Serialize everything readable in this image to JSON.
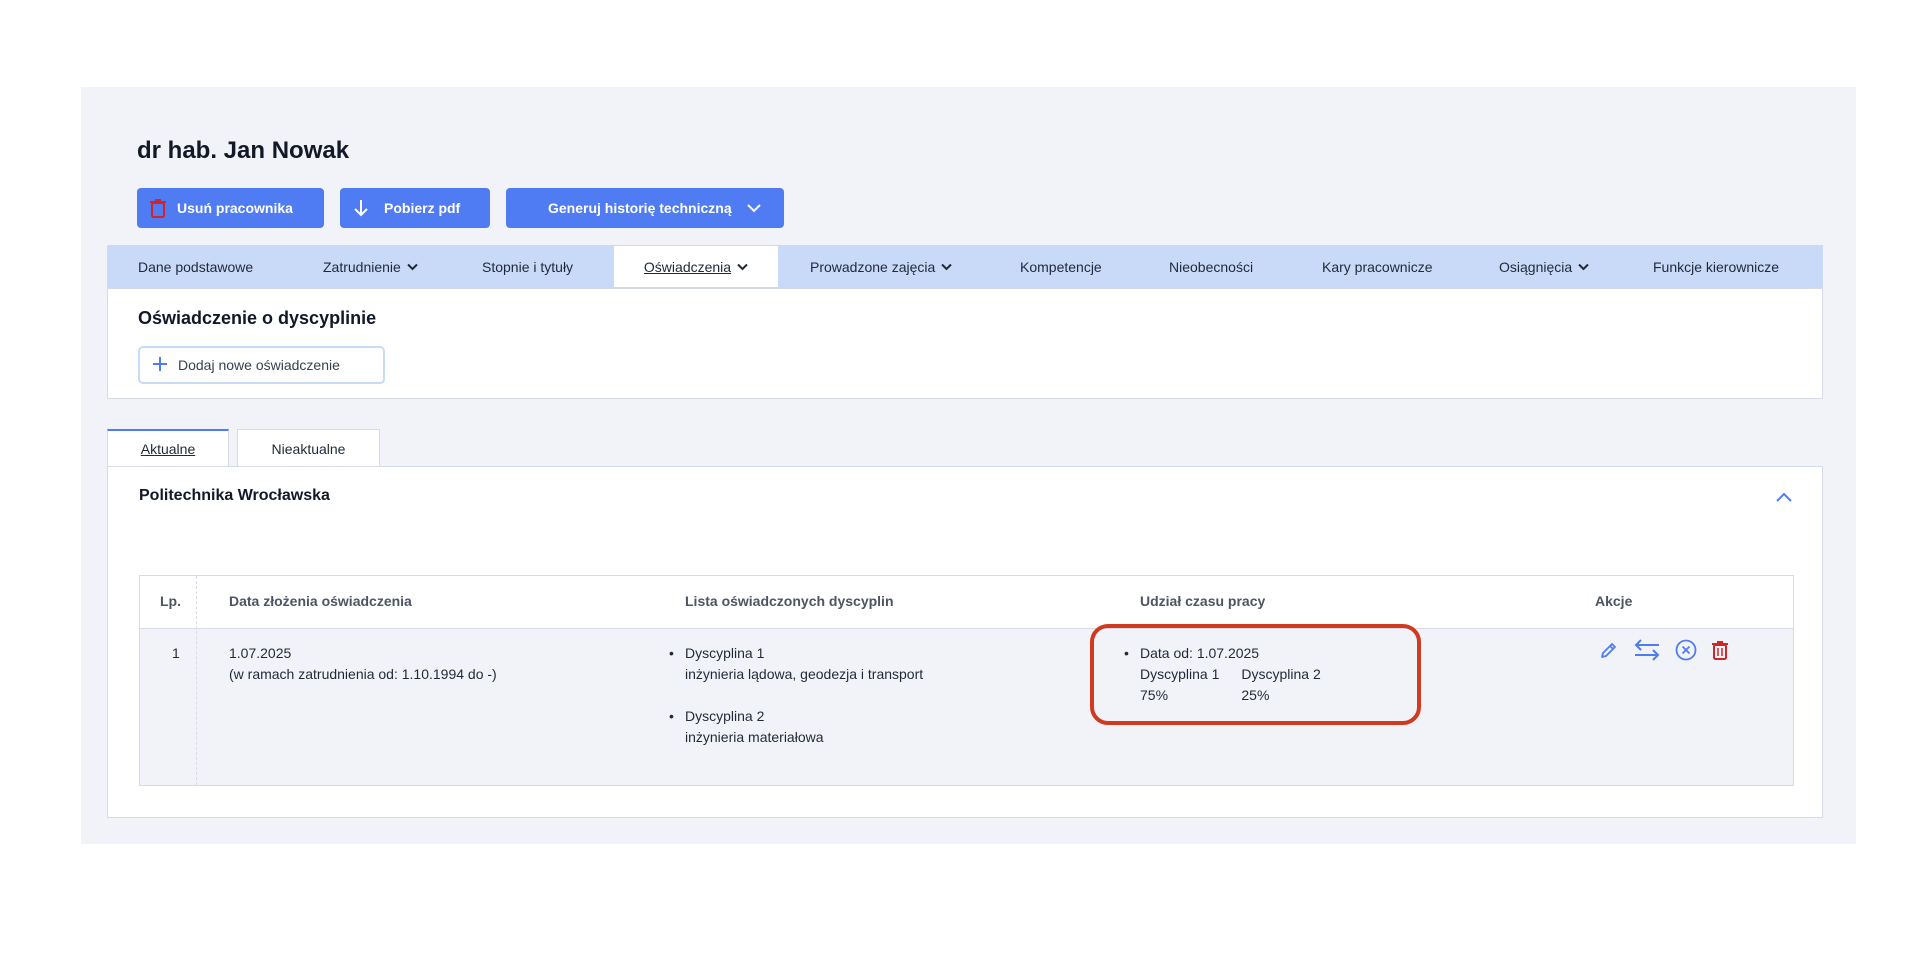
{
  "page": {
    "title": "dr hab. Jan Nowak"
  },
  "toolbar": {
    "delete_label": "Usuń pracownika",
    "pdf_label": "Pobierz pdf",
    "history_label": "Generuj historię techniczną"
  },
  "tabs": [
    {
      "label": "Dane podstawowe",
      "dropdown": false
    },
    {
      "label": "Zatrudnienie",
      "dropdown": true
    },
    {
      "label": "Stopnie i tytuły",
      "dropdown": false
    },
    {
      "label": "Oświadczenia",
      "dropdown": true,
      "active": true
    },
    {
      "label": "Prowadzone zajęcia",
      "dropdown": true
    },
    {
      "label": "Kompetencje",
      "dropdown": false
    },
    {
      "label": "Nieobecności",
      "dropdown": false
    },
    {
      "label": "Kary pracownicze",
      "dropdown": false
    },
    {
      "label": "Osiągnięcia",
      "dropdown": true
    },
    {
      "label": "Funkcje kierownicze",
      "dropdown": false
    }
  ],
  "section": {
    "heading": "Oświadczenie o dyscyplinie",
    "add_label": "Dodaj nowe oświadczenie"
  },
  "subtabs": [
    {
      "label": "Aktualne",
      "active": true
    },
    {
      "label": "Nieaktualne",
      "active": false
    }
  ],
  "card": {
    "org": "Politechnika Wrocławska",
    "table": {
      "headers": [
        "Lp.",
        "Data złożenia oświadczenia",
        "Lista oświadczonych dyscyplin",
        "Udział czasu pracy",
        "Akcje"
      ],
      "rows": [
        {
          "lp": "1",
          "date": "1.07.2025",
          "date_note": "(w ramach zatrudnienia od: 1.10.1994 do -)",
          "disciplines": [
            {
              "name": "Dyscyplina 1",
              "field": "inżynieria lądowa, geodezja i transport"
            },
            {
              "name": "Dyscyplina 2",
              "field": "inżynieria materiałowa"
            }
          ],
          "share_date": "Data od: 1.07.2025",
          "shares": [
            {
              "name": "Dyscyplina 1",
              "value": "75%"
            },
            {
              "name": "Dyscyplina 2",
              "value": "25%"
            }
          ]
        }
      ]
    }
  },
  "colors": {
    "accent": "#4f7cf3",
    "danger": "#d0242b",
    "highlight": "#d13a1f",
    "tabbar": "#c9d9f8",
    "panel": "#f2f3f9"
  },
  "icons": {
    "delete": "trash-icon",
    "download": "arrow-down-icon",
    "dropdown": "chevron-down-icon",
    "add": "plus-icon",
    "collapse": "chevron-up-icon",
    "edit": "pencil-icon",
    "transfer": "swap-arrows-icon",
    "cancel": "circle-x-icon"
  }
}
